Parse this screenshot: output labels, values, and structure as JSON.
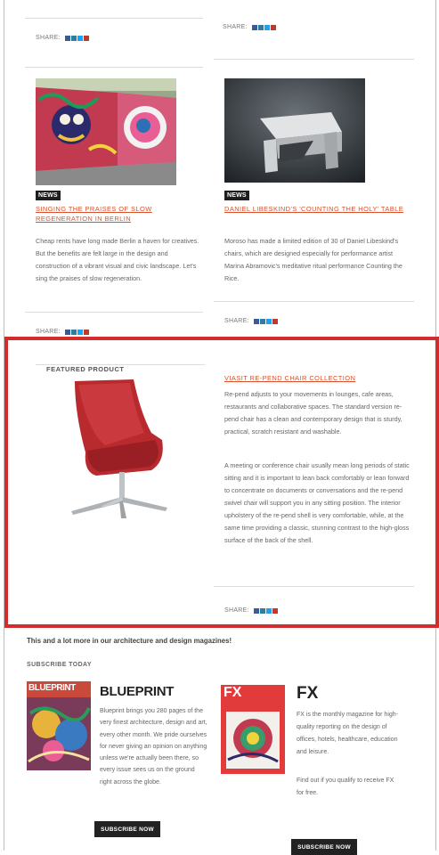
{
  "share_label": "SHARE:",
  "articles": [
    {
      "badge": "NEWS",
      "headline": "SINGING THE PRAISES OF SLOW REGENERATION IN BERLIN",
      "body": "Cheap rents have long made Berlin a haven for creatives. But the benefits are felt large in the design and construction of a vibrant visual and civic landscape. Let's sing the praises of slow regeneration."
    },
    {
      "badge": "NEWS",
      "headline": "DANIEL LIBESKIND'S 'COUNTING THE HOLY' TABLE",
      "body": "Moroso has made a limited edition of 30 of Daniel Libeskind's chairs, which are designed especially for performance artist Marina Abramovic's meditative ritual performance Counting the Rice."
    }
  ],
  "featured": {
    "label": "FEATURED PRODUCT",
    "headline": "VIASIT RE-PEND CHAIR COLLECTION",
    "paragraph1": "Re-pend adjusts to your movements in lounges, cafe areas, restaurants and collaborative spaces. The standard version re-pend chair has a clean and contemporary design that is sturdy, practical, scratch resistant and washable.",
    "paragraph2": "A meeting or conference chair usually mean long periods of static sitting and it is important to lean back comfortably or lean forward to concentrate on documents or conversations and the re-pend swivel chair will support you in any sitting position. The interior upholstery of the re-pend shell is very comfortable, while, at the same time providing a classic, stunning contrast to the high-gloss surface of the back of the shell."
  },
  "promo": {
    "intro": "This and a lot more in our architecture and design magazines!",
    "subscribe_label": "SUBSCRIBE TODAY",
    "magazines": [
      {
        "cover_text": "BLUEPRINT",
        "title": "BLUEPRINT",
        "body": "Blueprint brings you 280 pages of the very finest architecture, design and art, every other month. We pride ourselves for never giving an opinion on anything unless we're actually been there, so every issue sees us on the ground right across the globe.",
        "button": "SUBSCRIBE NOW"
      },
      {
        "cover_text": "FX",
        "title": "FX",
        "body1": "FX is the monthly magazine for high-quality reporting on the design of offices, hotels, healthcare, education and leisure.",
        "body2": "Find out if you qualify to receive FX for free.",
        "button": "SUBSCRIBE NOW"
      }
    ]
  }
}
